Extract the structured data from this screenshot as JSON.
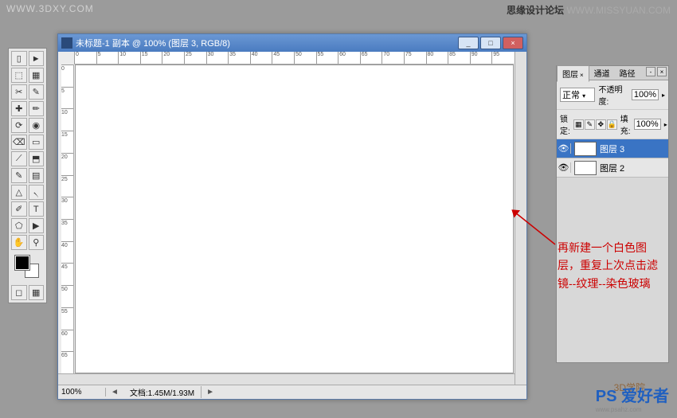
{
  "watermarks": {
    "top_left": "WWW.3DXY.COM",
    "top_right_forum": "思缘设计论坛",
    "top_right_url": " WWW.MISSYUAN.COM",
    "bottom_right": "PS 爱好者",
    "bottom_right_sub": "www.psahz.com",
    "mid_right": "3D学院"
  },
  "toolbox_tools": [
    [
      "▯",
      "►"
    ],
    [
      "⬚",
      "▦"
    ],
    [
      "✂",
      "✎"
    ],
    [
      "✚",
      "✏"
    ],
    [
      "⟳",
      "◉"
    ],
    [
      "⌫",
      "▭"
    ],
    [
      "⟋",
      "⬒"
    ],
    [
      "✎",
      "▤"
    ],
    [
      "△",
      "৲"
    ],
    [
      "✐",
      "T"
    ],
    [
      "⬠",
      "▶"
    ],
    [
      "✋",
      "⚲"
    ]
  ],
  "document": {
    "title": "未标题-1 副本 @ 100% (图层 3, RGB/8)",
    "zoom": "100%",
    "docinfo": "文档:1.45M/1.93M",
    "ruler_ticks": [
      "0",
      "5",
      "10",
      "15",
      "20",
      "25",
      "30",
      "35",
      "40",
      "45",
      "50",
      "55",
      "60",
      "65",
      "70",
      "75",
      "80",
      "85",
      "90",
      "95"
    ]
  },
  "layers_panel": {
    "tabs": [
      "图层",
      "通道",
      "路径"
    ],
    "blend_mode": "正常",
    "opacity_label": "不透明度:",
    "opacity_value": "100%",
    "lock_label": "锁定:",
    "fill_label": "填充:",
    "fill_value": "100%",
    "layers": [
      {
        "name": "图层 3",
        "selected": true
      },
      {
        "name": "图层 2",
        "selected": false
      }
    ]
  },
  "annotation": {
    "text": "再新建一个白色图层，重复上次点击滤镜--纹理--染色玻璃"
  },
  "win_btns": {
    "min": "_",
    "max": "□",
    "close": "×"
  }
}
